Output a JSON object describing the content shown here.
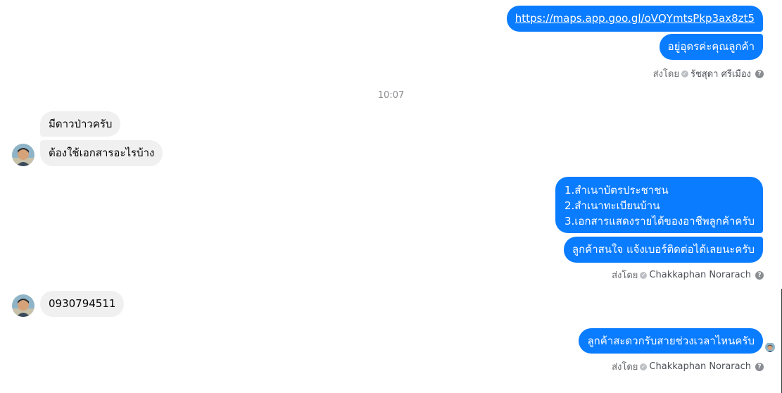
{
  "messages": {
    "m1_link": "https://maps.app.goo.gl/oVQYmtsPkp3ax8zt5",
    "m2": "อยู่อุดรค่ะคุณลูกค้า",
    "sent_by_1": {
      "prefix": "ส่งโดย",
      "sender": "รัชสุดา ศรีเมือง"
    },
    "timestamp": "10:07",
    "in1": "มีดาวป่าวครับ",
    "in2": "ต้องใช้เอกสารอะไรบ้าง",
    "m3": {
      "line1": "1.สำเนาบัตรประชาชน",
      "line2": "2.สำเนาทะเบียนบ้าน",
      "line3": "3.เอกสารแสดงรายได้ของอาชีพลูกค้าครับ"
    },
    "m4": "ลูกค้าสนใจ แจ้งเบอร์ติดต่อได้เลยนะครับ",
    "sent_by_2": {
      "prefix": "ส่งโดย",
      "sender": "Chakkaphan Norarach"
    },
    "in3": "0930794511",
    "m5": "ลูกค้าสะดวกรับสายช่วงเวลาไหนครับ",
    "sent_by_3": {
      "prefix": "ส่งโดย",
      "sender": "Chakkaphan Norarach"
    }
  },
  "icons": {
    "check": "check-circle-icon",
    "help": "question-circle-icon",
    "avatar": "contact-avatar"
  },
  "colors": {
    "outgoing": "#0a7cff",
    "incoming": "#f0f0f0",
    "meta_text": "#65676b"
  }
}
